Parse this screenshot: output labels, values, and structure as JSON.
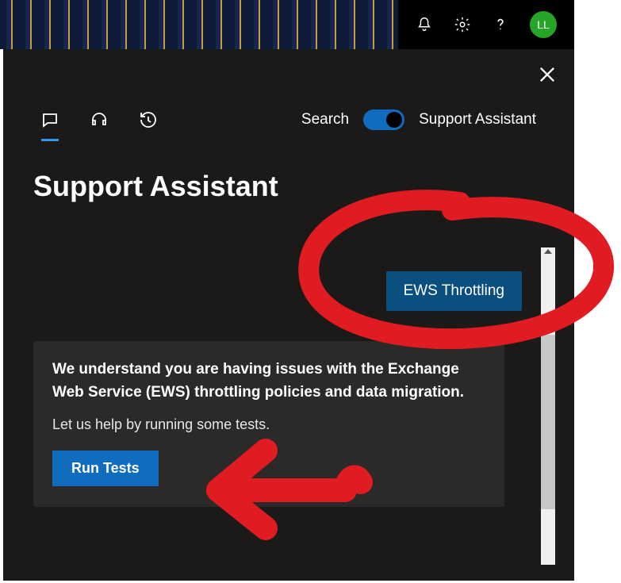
{
  "colors": {
    "accent_blue": "#0f6cbf",
    "toggle_blue": "#0f6cbf",
    "avatar_green": "#26a626",
    "annotation_red": "#e11b22"
  },
  "topbar": {
    "avatar_initials": "LL"
  },
  "panel": {
    "tabs": {
      "chat_icon": "chat-icon",
      "headset_icon": "headset-icon",
      "history_icon": "history-icon",
      "active_index": 0
    },
    "mode": {
      "search_label": "Search",
      "assistant_label": "Support Assistant",
      "toggle_on": true
    },
    "title": "Support Assistant",
    "user_message": "EWS Throttling",
    "assistant": {
      "headline": "We understand you are having issues with the Exchange Web Service (EWS) throttling policies and data migration.",
      "subline": "Let us help by running some tests.",
      "button_label": "Run Tests"
    }
  }
}
